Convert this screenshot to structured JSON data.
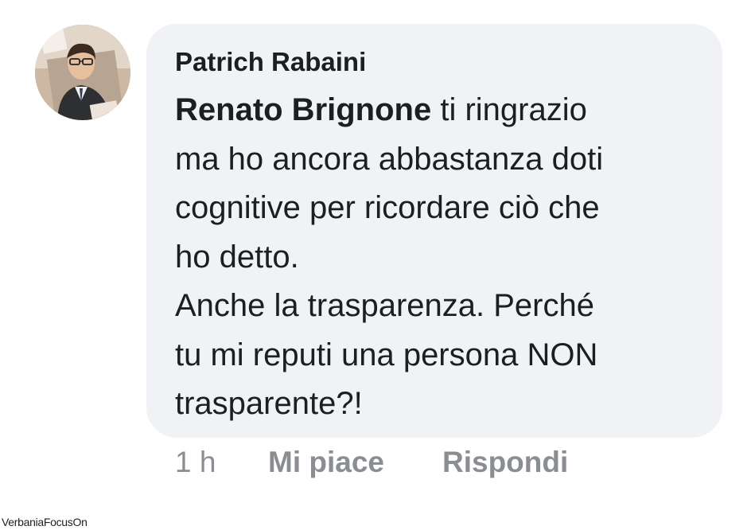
{
  "comment": {
    "author": "Patrich Rabaini",
    "mention": "Renato Brignone",
    "first_line_rest": " ti ringrazio",
    "body_lines": [
      "ma ho ancora abbastanza doti",
      "cognitive per ricordare ciò che",
      "ho detto.",
      "Anche la trasparenza. Perché",
      "tu mi reputi una persona NON",
      "trasparente?!"
    ]
  },
  "actions": {
    "time": "1 h",
    "like_label": "Mi piace",
    "reply_label": "Rispondi"
  },
  "watermark": "VerbaniaFocusOn",
  "colors": {
    "bubble": "#f0f2f5",
    "text": "#1c1e21",
    "muted": "#8a8d91"
  }
}
